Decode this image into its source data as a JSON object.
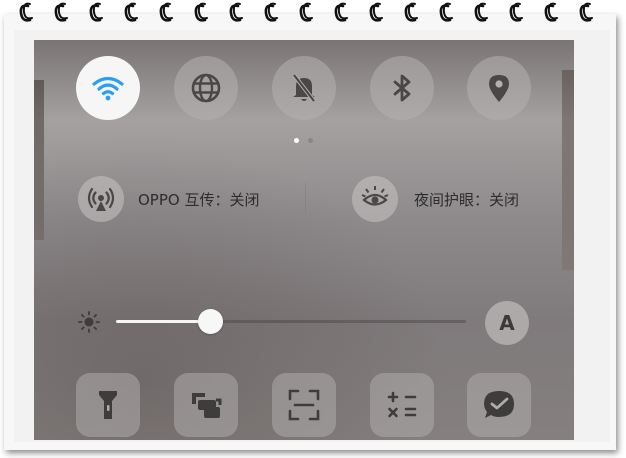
{
  "colors": {
    "wifi_active": "#2a9df4",
    "icon": "#4a4747",
    "text": "#2d2d2d",
    "toggle_on_bg": "#f6f6f6",
    "page_dot_active": "#ffffff",
    "page_dot_inactive": "#8a8686"
  },
  "quick_toggles": [
    {
      "icon": "wifi-icon",
      "active": true
    },
    {
      "icon": "globe-icon",
      "active": false
    },
    {
      "icon": "bell-muted-icon",
      "active": false
    },
    {
      "icon": "bluetooth-icon",
      "active": false
    },
    {
      "icon": "location-pin-icon",
      "active": false
    }
  ],
  "pager": {
    "pages": 2,
    "current": 1
  },
  "info": {
    "oppo_share": {
      "icon": "broadcast-icon",
      "label": "OPPO 互传：关闭"
    },
    "night_mode": {
      "icon": "eye-sun-icon",
      "label": "夜间护眼：关闭"
    }
  },
  "brightness": {
    "icon": "sun-icon",
    "level": 0.27,
    "auto_label": "A"
  },
  "shortcut_tiles": [
    {
      "icon": "flashlight-icon"
    },
    {
      "icon": "screen-record-icon"
    },
    {
      "icon": "screenshot-icon"
    },
    {
      "icon": "calculator-icon"
    },
    {
      "icon": "chat-bubble-icon"
    }
  ]
}
